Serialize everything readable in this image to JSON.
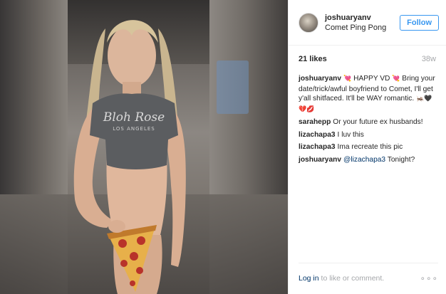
{
  "post": {
    "username": "joshuaryanv",
    "location": "Comet Ping Pong",
    "follow_label": "Follow",
    "likes": "21 likes",
    "time_ago": "38w",
    "shirt_text_line1": "Bloh Rose",
    "shirt_text_line2": "LOS ANGELES"
  },
  "comments": [
    {
      "user": "joshuaryanv",
      "text_before": "",
      "emoji_1": "💘",
      "text": " HAPPY VD ",
      "emoji_2": "💘",
      "text_2": " Bring your date/trick/awful boyfriend to Comet, I'll get y'all shitfaced. It'll be WAY romantic. ",
      "emoji_3": "🦗🖤💔💋"
    },
    {
      "user": "sarahepp",
      "text": "Or your future ex husbands!"
    },
    {
      "user": "lizachapa3",
      "text": "I luv this"
    },
    {
      "user": "lizachapa3",
      "text": "Ima recreate this pic"
    },
    {
      "user": "joshuaryanv",
      "mention": "@lizachapa3",
      "text": " Tonight?"
    }
  ],
  "footer": {
    "login_link": "Log in",
    "login_rest": " to like or comment.",
    "more": "∘∘∘"
  },
  "icons": {
    "more": "more-options-icon"
  },
  "colors": {
    "accent": "#3897f0",
    "link": "#003569",
    "muted": "#a5a7aa"
  }
}
